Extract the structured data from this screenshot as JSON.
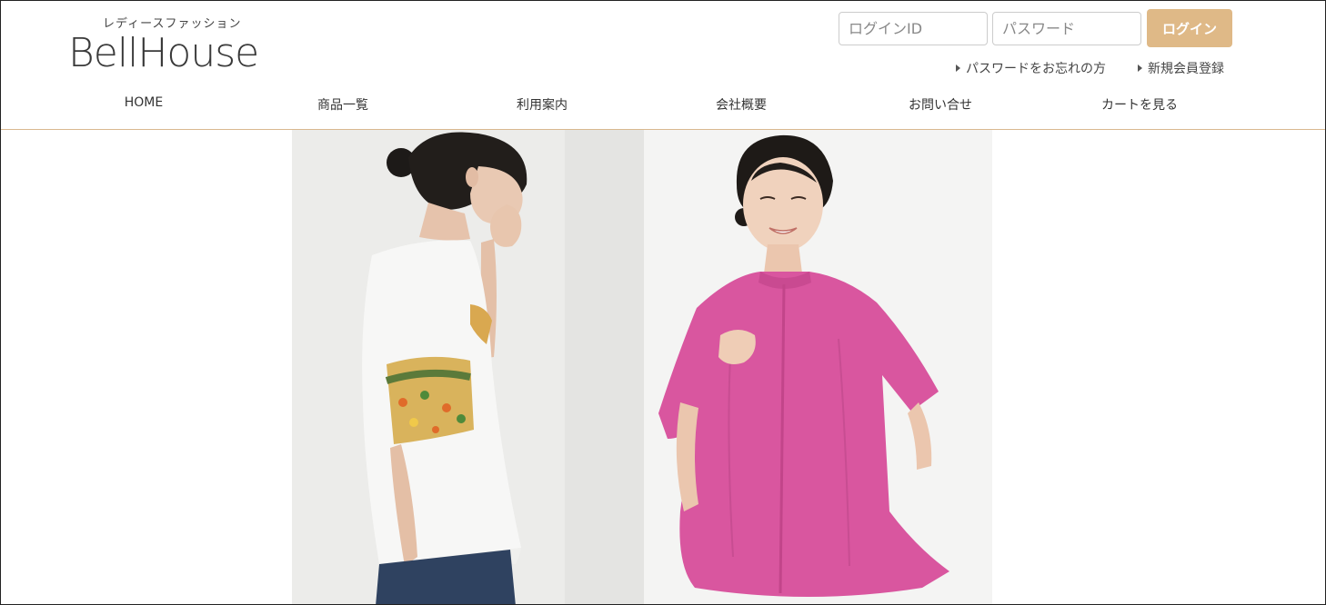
{
  "logo": {
    "tagline": "レディースファッション",
    "name": "BellHouse"
  },
  "login": {
    "id_placeholder": "ログインID",
    "password_placeholder": "パスワード",
    "button_label": "ログイン",
    "forgot_password": "パスワードをお忘れの方",
    "register": "新規会員登録"
  },
  "nav": {
    "items": [
      {
        "label": "HOME"
      },
      {
        "label": "商品一覧"
      },
      {
        "label": "利用案内"
      },
      {
        "label": "会社概要"
      },
      {
        "label": "お問い合せ"
      },
      {
        "label": "カートを見る"
      }
    ]
  },
  "colors": {
    "accent": "#dfb987",
    "divider": "#d9b88f",
    "blouse": "#d9569f"
  },
  "hero": {
    "images": [
      {
        "icon": "model-white-tshirt-floral-sleeve-photo"
      },
      {
        "icon": "model-pink-blouse-photo"
      }
    ]
  }
}
